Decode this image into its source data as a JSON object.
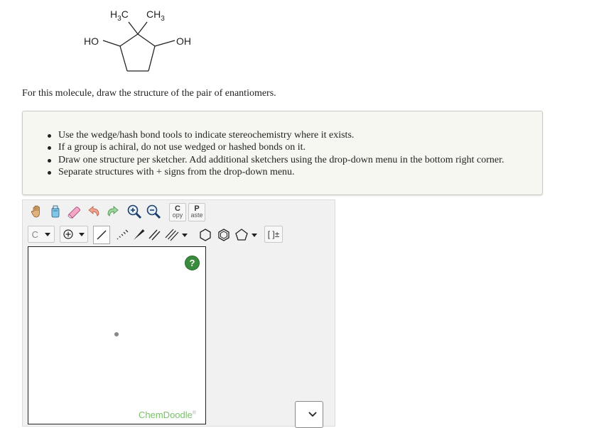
{
  "molecule": {
    "methyl_1": "H",
    "methyl_1_sub": "3",
    "methyl_1_tail": "C",
    "methyl_2": "CH",
    "methyl_2_sub": "3",
    "hydroxyl_left": "HO",
    "hydroxyl_right": "OH"
  },
  "prompt": "For this molecule, draw the structure of the pair of enantiomers.",
  "instructions": [
    "Use the wedge/hash bond tools to indicate stereochemistry where it exists.",
    "If a group is achiral, do not use wedged or hashed bonds on it.",
    "Draw one structure per sketcher. Add additional sketchers using the drop-down menu in the bottom right corner.",
    "Separate structures with + signs from the drop-down menu."
  ],
  "toolbar": {
    "copy_top": "C",
    "copy_bottom": "opy",
    "paste_top": "P",
    "paste_bottom": "aste",
    "atom_select": "C",
    "charge_label": "[ ]±",
    "icons": [
      "hand-icon",
      "clear-icon",
      "eraser-icon",
      "undo-icon",
      "redo-icon",
      "zoom-in-icon",
      "zoom-out-icon",
      "charge-plus-icon",
      "single-bond-icon",
      "hash-bond-icon",
      "wedge-bond-icon",
      "double-bond-icon",
      "triple-bond-icon",
      "cyclohexane-icon",
      "benzene-icon",
      "cyclopentane-icon"
    ]
  },
  "canvas": {
    "help": "?",
    "watermark": "ChemDoodle",
    "watermark_mark": "®"
  },
  "colors": {
    "help": "#3b8b3f",
    "watermark": "#79c169",
    "panel": "#f6f7f1"
  }
}
